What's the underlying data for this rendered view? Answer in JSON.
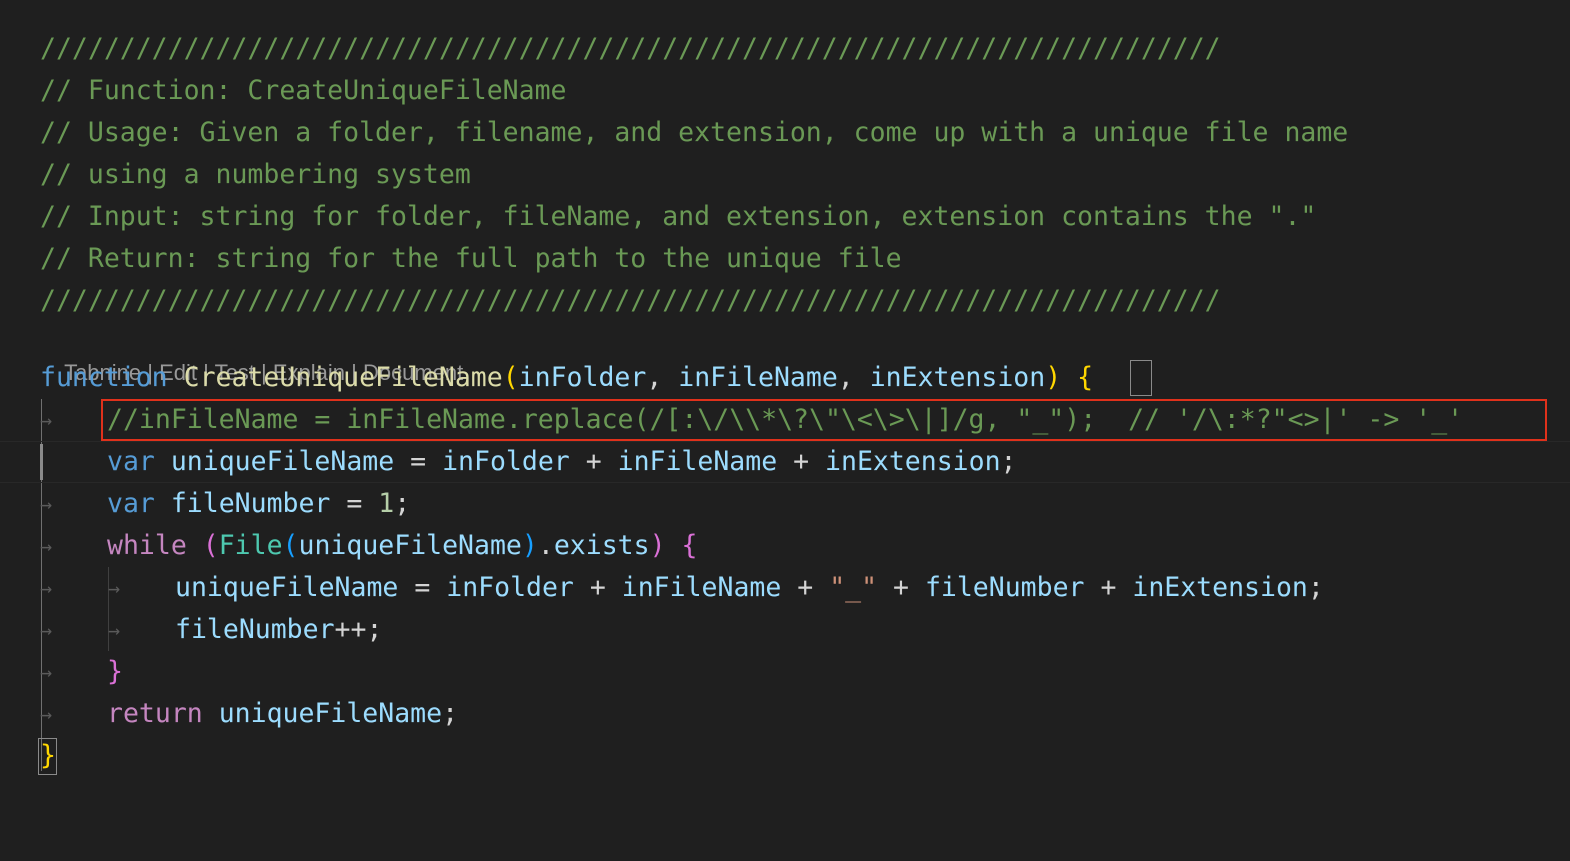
{
  "editor": {
    "comment_lines": [
      "//////////////////////////////////////////////////////////////////////////",
      "// Function: CreateUniqueFileName",
      "// Usage: Given a folder, filename, and extension, come up with a unique file name",
      "// using a numbering system",
      "// Input: string for folder, fileName, and extension, extension contains the \".\"",
      "// Return: string for the full path to the unique file",
      "//////////////////////////////////////////////////////////////////////////"
    ],
    "codelens": {
      "tabnine": "Tabnine",
      "edit": "Edit",
      "test": "Test",
      "explain": "Explain",
      "document": "Document",
      "separator": " | "
    },
    "code": {
      "function_kw": "function",
      "function_name": "CreateUniqueFileName",
      "param1": "inFolder",
      "param2": "inFileName",
      "param3": "inExtension",
      "commented_replace_line": "//inFileName = inFileName.replace(/[:\\/\\\\*\\?\\\"\\<\\>\\|]/g, \"_\");  // '/\\:*?\"<>|' -> '_'",
      "var_kw": "var",
      "unique_var": "uniqueFileName",
      "file_number_var": "fileNumber",
      "one": "1",
      "while_kw": "while",
      "file_class": "File",
      "exists_prop": "exists",
      "underscore_str": "\"_\"",
      "increment": "++",
      "return_kw": "return"
    }
  }
}
